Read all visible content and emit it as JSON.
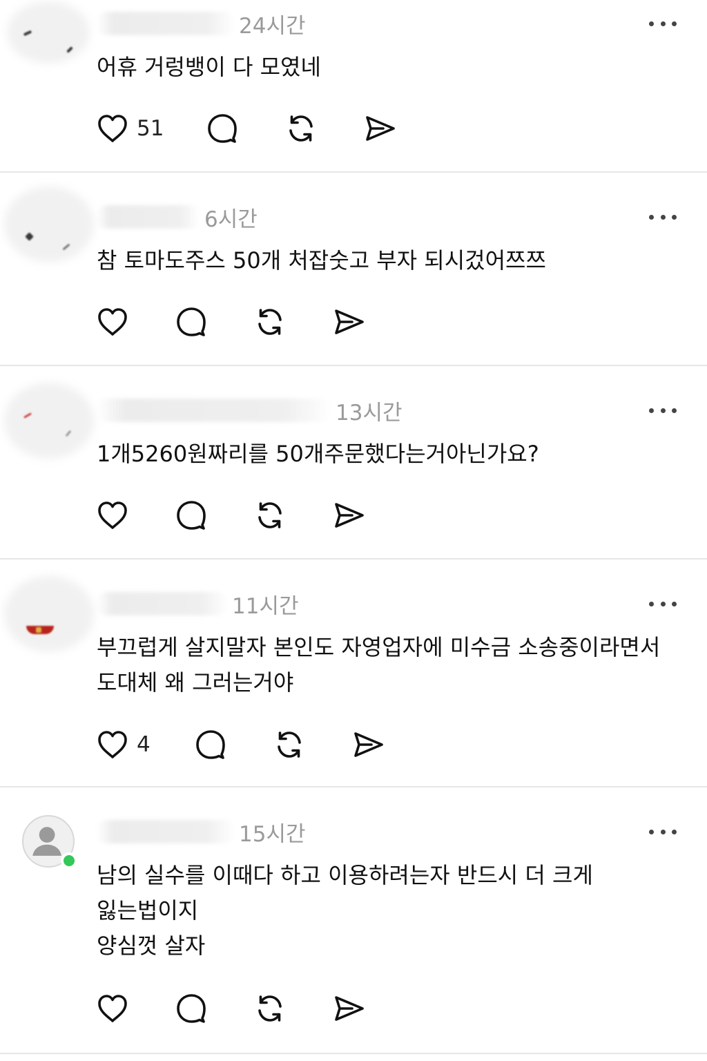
{
  "posts": [
    {
      "timestamp": "24시간",
      "text": "어휴 거렁뱅이 다 모였네",
      "like_count": "51"
    },
    {
      "timestamp": "6시간",
      "text": "참 토마도주스 50개 처잡숫고 부자 되시겄어쯔쯔",
      "like_count": ""
    },
    {
      "timestamp": "13시간",
      "text": "1개5260원짜리를 50개주문했다는거아닌가요?",
      "like_count": ""
    },
    {
      "timestamp": "11시간",
      "text": "부끄럽게 살지말자 본인도 자영업자에 미수금 소송중이라면서\n도대체 왜 그러는거야",
      "like_count": "4"
    },
    {
      "timestamp": "15시간",
      "text": "남의 실수를 이때다 하고 이용하려는자 반드시 더 크게\n잃는법이지\n양심껏 살자",
      "like_count": ""
    }
  ],
  "icons": {
    "like": "heart-icon",
    "comment": "comment-bubble-icon",
    "repost": "repost-icon",
    "share": "send-icon",
    "more": "more-horizontal-icon",
    "default_avatar": "user-silhouette-icon"
  },
  "colors": {
    "online_dot": "#34c759",
    "timestamp": "#9a9a9a",
    "divider": "#e6e6e6"
  }
}
